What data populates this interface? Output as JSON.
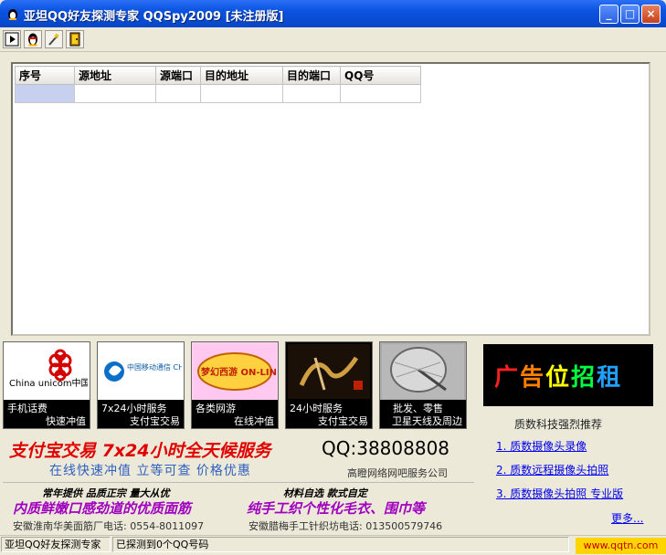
{
  "window": {
    "title": "亚坦QQ好友探测专家 QQSpy2009 [未注册版]",
    "controls": {
      "minimize": "_",
      "maximize": "□",
      "close": "×"
    }
  },
  "toolbar": {
    "items": [
      {
        "icon": "play-icon"
      },
      {
        "icon": "qq-penguin-icon"
      },
      {
        "icon": "magic-wand-icon"
      },
      {
        "icon": "exit-door-icon"
      }
    ]
  },
  "table": {
    "columns": [
      "序号",
      "源地址",
      "源端口",
      "目的地址",
      "目的端口",
      "QQ号"
    ],
    "rows": [
      [
        "",
        "",
        "",
        "",
        "",
        ""
      ]
    ]
  },
  "ads": [
    {
      "logo": "China unicom中国联通",
      "line1": "手机话费",
      "line2": "快速冲值"
    },
    {
      "logo": "中国移动通信 CHINA MOBILE",
      "line1": "7x24小时服务",
      "line2": "支付宝交易"
    },
    {
      "logo": "梦幻西游 ON-LINE",
      "line1": "各类网游",
      "line2": "在线冲值"
    },
    {
      "logo": "",
      "line1": "24小时服务",
      "line2": "支付宝交易"
    },
    {
      "logo": "",
      "line1": "批发、零售",
      "line2": "卫星天线及周边"
    }
  ],
  "promo": {
    "headline": "支付宝交易 7x24小时全天候服务",
    "qq": "QQ:38808808",
    "subline": "在线快速冲值 立等可查 价格优惠",
    "company": "高瞪网络网吧服务公司",
    "left_tag": "常年提供 品质正宗 量大从优",
    "left_main": "内质鲜嫩口感劲道的优质面筋",
    "left_contact": "安徽淮南华美面筋厂电话: 0554-8011097",
    "right_tag": "材料自选 款式自定",
    "right_main": "纯手工织个性化毛衣、围巾等",
    "right_contact": "安徽腊梅手工针织坊电话: 013500579746"
  },
  "right_panel": {
    "rent": [
      "广",
      "告",
      "位",
      "招",
      "租"
    ],
    "rent_colors": [
      "#ff2020",
      "#ff8000",
      "#ffff00",
      "#00ff40",
      "#20a0ff"
    ],
    "rec_title": "质数科技强烈推荐",
    "links": [
      "1. 质数摄像头录像",
      "2. 质数远程摄像头拍照",
      "3. 质数摄像头拍照 专业版"
    ],
    "more": "更多..."
  },
  "status": {
    "app": "亚坦QQ好友探测专家",
    "message": "已探测到0个QQ号码",
    "watermark": "www.qqtn.com"
  },
  "colors": {
    "titlebar": "#0a53e0",
    "window_bg": "#ece9d8",
    "headline_red": "#e00000",
    "link_blue": "#0000ee",
    "selected_cell": "#c8d0f0"
  }
}
